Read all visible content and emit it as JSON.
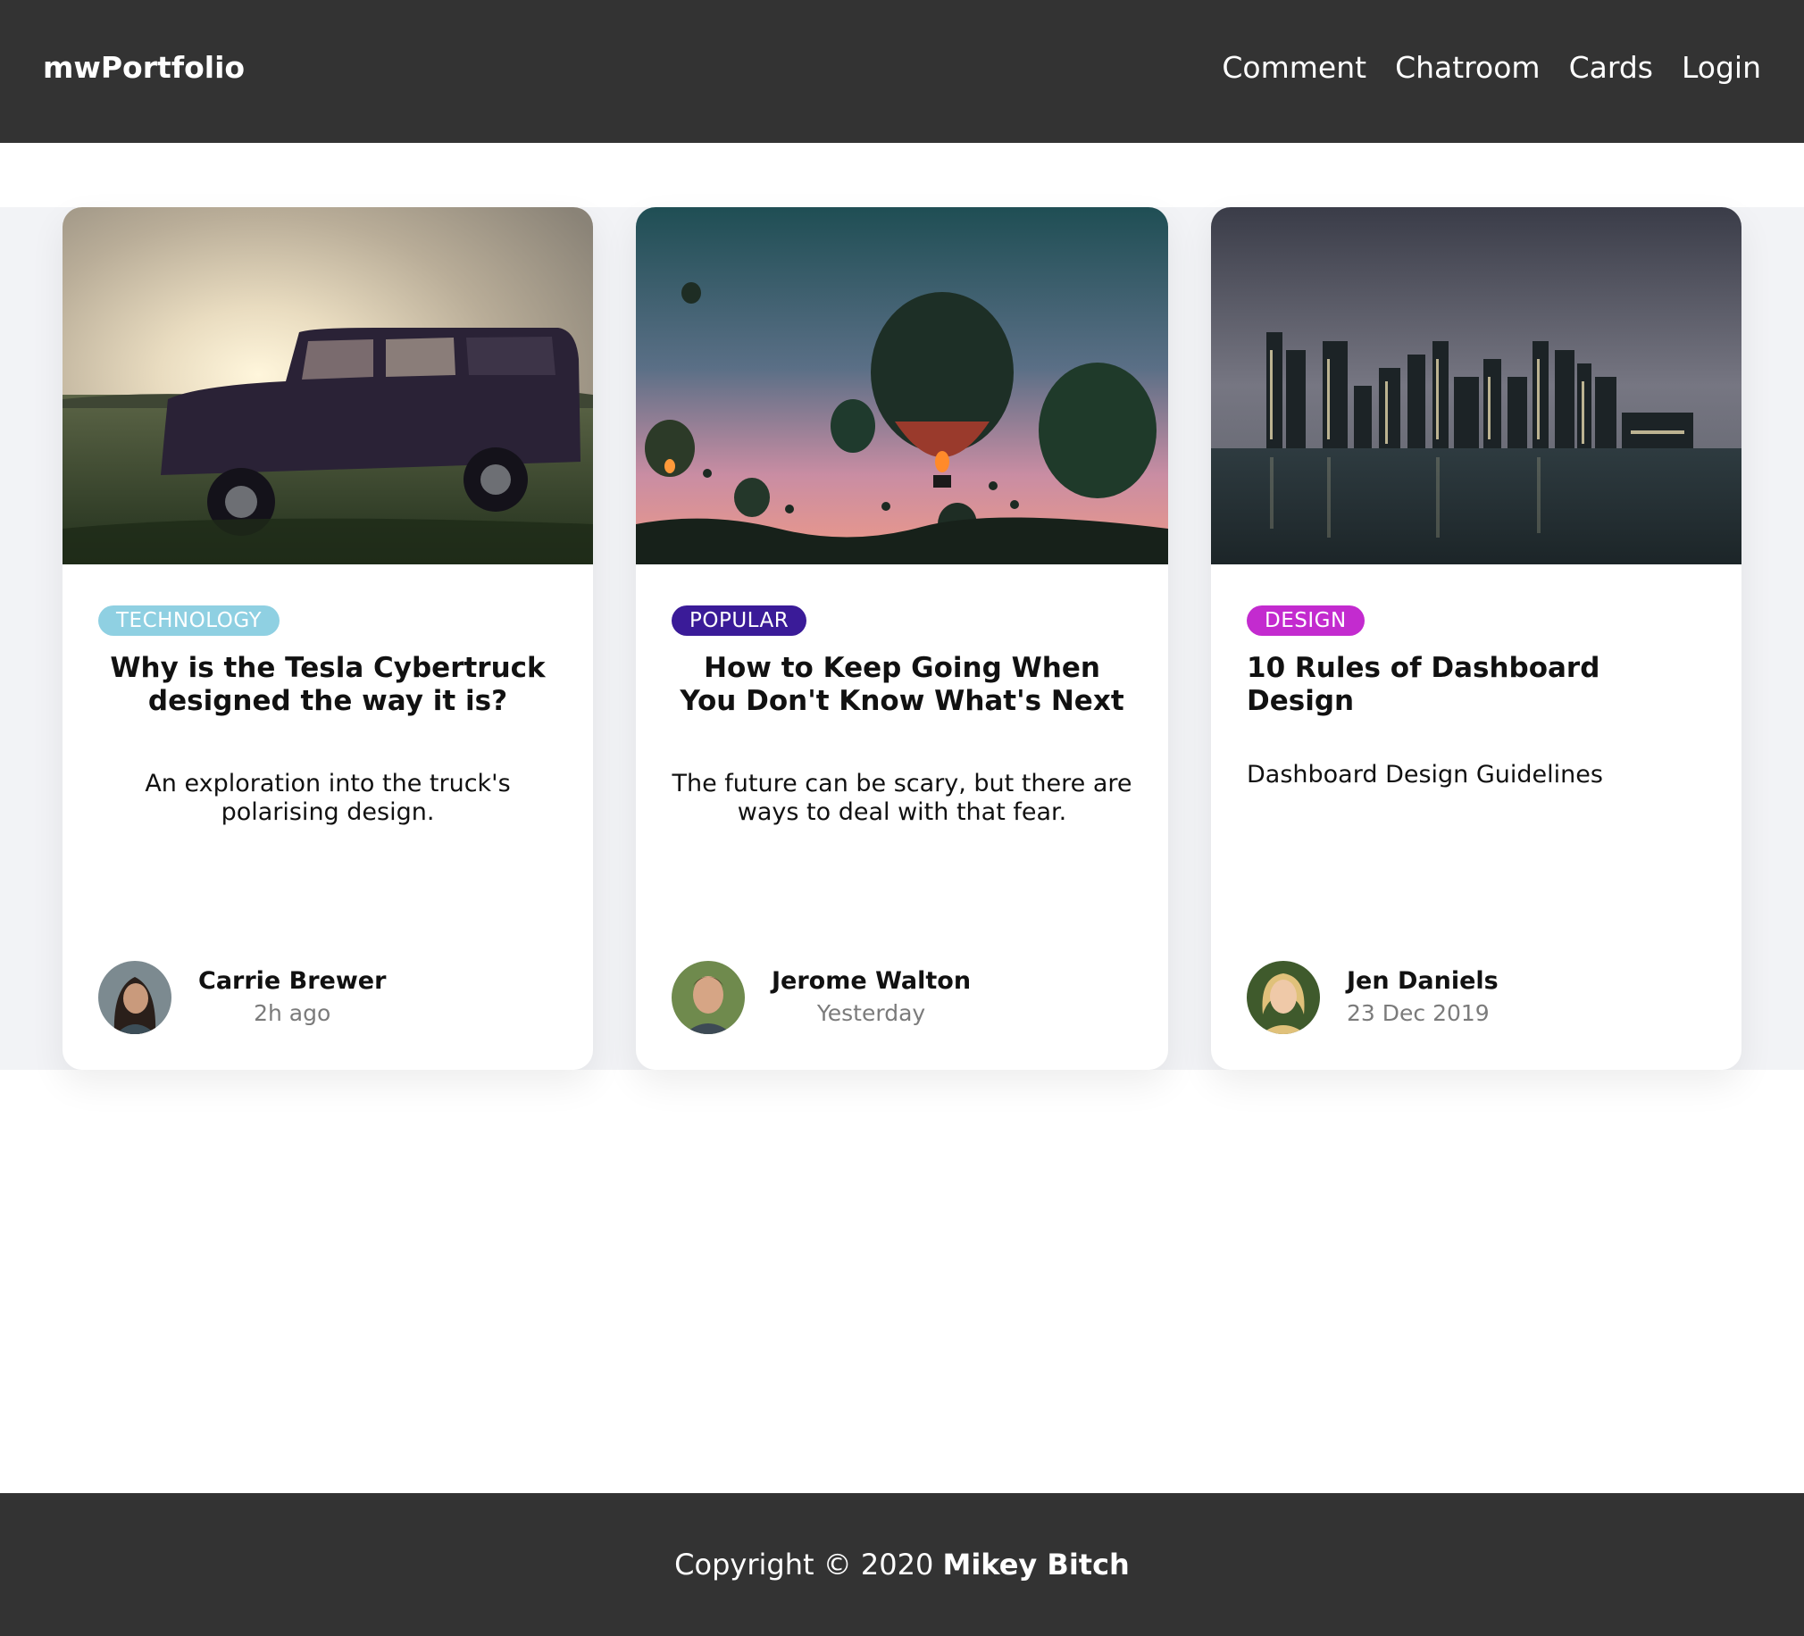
{
  "navbar": {
    "brand": "mwPortfolio",
    "links": [
      "Comment",
      "Chatroom",
      "Cards",
      "Login"
    ]
  },
  "cards": [
    {
      "tag": "TECHNOLOGY",
      "tag_color": "#8fd0e2",
      "title": "Why is the Tesla Cybertruck designed the way it is?",
      "text": "An exploration into the truck's polarising design.",
      "author": "Carrie Brewer",
      "time": "2h ago",
      "image": "jeep-at-sunset-photo"
    },
    {
      "tag": "POPULAR",
      "tag_color": "#3a1b98",
      "title": "How to Keep Going When You Don't Know What's Next",
      "text": "The future can be scary, but there are ways to deal with that fear.",
      "author": "Jerome Walton",
      "time": "Yesterday",
      "image": "hot-air-balloons-photo"
    },
    {
      "tag": "DESIGN",
      "tag_color": "#c32bcf",
      "title": "10 Rules of Dashboard Design",
      "text": "Dashboard Design Guidelines",
      "author": "Jen Daniels",
      "time": "23 Dec 2019",
      "image": "city-skyline-photo"
    }
  ],
  "footer": {
    "copyright": "Copyright © 2020",
    "author": "Mikey Bitch"
  },
  "colors": {
    "navbar_bg": "#333333",
    "band_bg": "#f2f3f6"
  }
}
